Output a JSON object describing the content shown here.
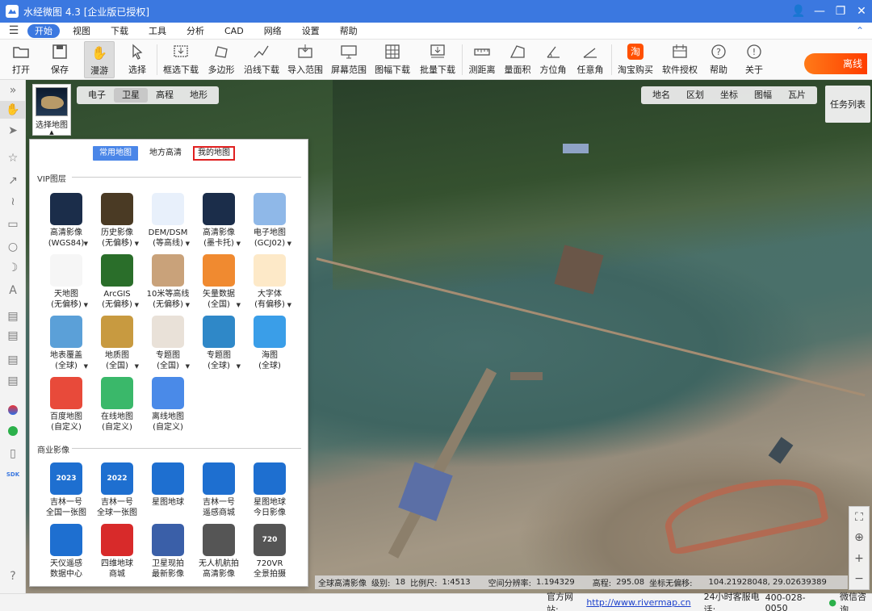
{
  "window": {
    "title": "水经微图 4.3 [企业版已授权]"
  },
  "menu": {
    "items": [
      "开始",
      "视图",
      "下载",
      "工具",
      "分析",
      "CAD",
      "网络",
      "设置",
      "帮助"
    ],
    "active": 0
  },
  "toolbar": {
    "items": [
      "打开",
      "保存",
      "漫游",
      "选择",
      "框选下载",
      "多边形",
      "沿线下载",
      "导入范围",
      "屏幕范围",
      "图幅下载",
      "批量下载",
      "测距离",
      "量面积",
      "方位角",
      "任意角",
      "淘宝购买",
      "软件授权",
      "帮助",
      "关于"
    ],
    "selected": "漫游",
    "promo": "离线"
  },
  "map": {
    "type_tabs": [
      "电子",
      "卫星",
      "高程",
      "地形"
    ],
    "type_selected": "卫星",
    "right_tabs": [
      "地名",
      "区划",
      "坐标",
      "图幅",
      "瓦片"
    ],
    "task_list": "任务列表",
    "map_select_label": "选择地图"
  },
  "panel": {
    "tabs": [
      "常用地图",
      "地方高清",
      "我的地图"
    ],
    "tab_selected": "常用地图",
    "tab_highlighted": "我的地图",
    "vip_title": "VIP图层",
    "vip_tiles": [
      {
        "line1": "高清影像",
        "line2": "(WGS84)",
        "icon": "world-night-icon",
        "color": "#1b2d4a",
        "dropdown": true
      },
      {
        "line1": "历史影像",
        "line2": "(无偏移)",
        "icon": "world-history-icon",
        "color": "#4a3a24",
        "dropdown": true
      },
      {
        "line1": "DEM/DSM",
        "line2": "(等高线)",
        "icon": "contour-icon",
        "color": "#e8f0fb",
        "dropdown": true
      },
      {
        "line1": "高清影像",
        "line2": "(墨卡托)",
        "icon": "world-night-icon",
        "color": "#1b2d4a",
        "dropdown": true
      },
      {
        "line1": "电子地图",
        "line2": "(GCJ02)",
        "icon": "world-map-icon",
        "color": "#8fb8e8",
        "dropdown": true
      },
      {
        "line1": "天地图",
        "line2": "(无偏移)",
        "icon": "tianditu-icon",
        "color": "#f6f6f6",
        "dropdown": true
      },
      {
        "line1": "ArcGIS",
        "line2": "(无偏移)",
        "icon": "arcgis-globe-icon",
        "color": "#2a6e2a",
        "dropdown": true
      },
      {
        "line1": "10米等高线",
        "line2": "(无偏移)",
        "icon": "terrain-icon",
        "color": "#c9a27a",
        "dropdown": true
      },
      {
        "line1": "矢量数据",
        "line2": "(全国)",
        "icon": "vector-map-icon",
        "color": "#f08a30",
        "dropdown": true
      },
      {
        "line1": "大字体",
        "line2": "(有偏移)",
        "icon": "letter-a-icon",
        "color": "#fde9c8",
        "dropdown": true
      },
      {
        "line1": "地表覆盖",
        "line2": "(全球)",
        "icon": "landcover-icon",
        "color": "#5ba0d8",
        "dropdown": true
      },
      {
        "line1": "地质图",
        "line2": "(全国)",
        "icon": "geology-icon",
        "color": "#c89a40",
        "dropdown": true
      },
      {
        "line1": "专题图",
        "line2": "(全国)",
        "icon": "china-thematic-icon",
        "color": "#e9e1d8",
        "dropdown": true
      },
      {
        "line1": "专题图",
        "line2": "(全球)",
        "icon": "globe-thematic-icon",
        "color": "#2f88c8",
        "dropdown": true
      },
      {
        "line1": "海图",
        "line2": "(全球)",
        "icon": "ship-icon",
        "color": "#3a9ee8",
        "dropdown": false
      },
      {
        "line1": "百度地图",
        "line2": "(自定义)",
        "icon": "baidu-map-icon",
        "color": "#e84a3a",
        "dropdown": false
      },
      {
        "line1": "在线地图",
        "line2": "(自定义)",
        "icon": "online-map-icon",
        "color": "#3ab86a",
        "dropdown": false
      },
      {
        "line1": "离线地图",
        "line2": "(自定义)",
        "icon": "offline-map-icon",
        "color": "#4a8ae8",
        "dropdown": false
      }
    ],
    "commercial_title": "商业影像",
    "commercial_tiles": [
      {
        "line1": "吉林一号",
        "line2": "全国一张图",
        "icon": "jilin-2023-icon",
        "badge": "2023",
        "color": "#1e6fd0"
      },
      {
        "line1": "吉林一号",
        "line2": "全球一张图",
        "icon": "jilin-2022-icon",
        "badge": "2022",
        "color": "#1e6fd0"
      },
      {
        "line1": "星图地球",
        "line2": "",
        "icon": "geovis-icon",
        "badge": "",
        "color": "#1e6fd0"
      },
      {
        "line1": "吉林一号",
        "line2": "遥感商城",
        "icon": "jilin-mall-icon",
        "badge": "",
        "color": "#1e6fd0"
      },
      {
        "line1": "星图地球",
        "line2": "今日影像",
        "icon": "geovis-today-icon",
        "badge": "",
        "color": "#1e6fd0"
      },
      {
        "line1": "天仪遥感",
        "line2": "数据中心",
        "icon": "spacety-icon",
        "badge": "",
        "color": "#1e6fd0"
      },
      {
        "line1": "四维地球",
        "line2": "商城",
        "icon": "siwei-icon",
        "badge": "",
        "color": "#d82a2a"
      },
      {
        "line1": "卫星现拍",
        "line2": "最新影像",
        "icon": "satellite-icon",
        "badge": "",
        "color": "#3a5fa8"
      },
      {
        "line1": "无人机航拍",
        "line2": "高清影像",
        "icon": "drone-icon",
        "badge": "",
        "color": "#555555"
      },
      {
        "line1": "720VR",
        "line2": "全景拍摄",
        "icon": "vr720-icon",
        "badge": "720",
        "color": "#555555"
      }
    ]
  },
  "status": {
    "layer": "全球高清影像",
    "level_label": "级别:",
    "level": "18",
    "scale_label": "比例尺:",
    "scale": "1:4513",
    "resolution_label": "空间分辨率:",
    "resolution": "1.194329",
    "elevation_label": "高程:",
    "elevation": "295.08",
    "coord_label": "坐标无偏移:",
    "coords": "104.21928048, 29.02639389"
  },
  "footer": {
    "site_label": "官方网站:",
    "site_url": "http://www.rivermap.cn",
    "hotline_label": "24小时客服电话:",
    "hotline": "400-028-0050",
    "wechat": "微信咨询"
  },
  "colors": {
    "accent": "#3b78e0",
    "highlight_red": "#e02020",
    "promo": "#ff5a10"
  }
}
